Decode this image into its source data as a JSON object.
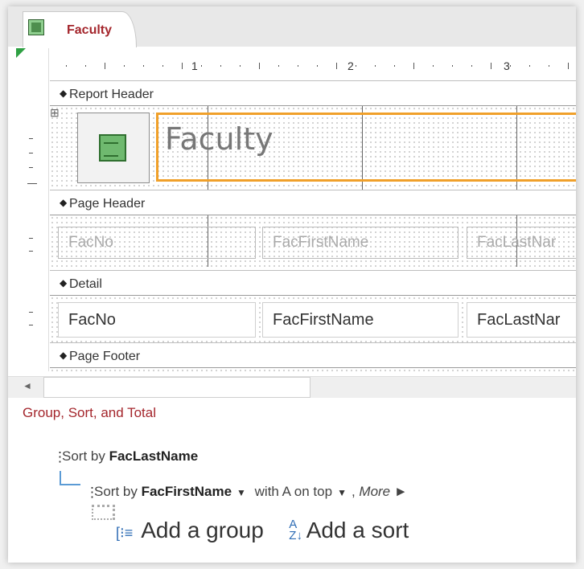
{
  "tab": {
    "label": "Faculty"
  },
  "ruler": {
    "numbers": [
      "1",
      "2",
      "3"
    ]
  },
  "bands": {
    "report_header": "Report Header",
    "page_header": "Page Header",
    "detail": "Detail",
    "page_footer": "Page Footer"
  },
  "report_header": {
    "title": "Faculty"
  },
  "page_header_labels": [
    "FacNo",
    "FacFirstName",
    "FacLastNar"
  ],
  "detail_fields": [
    "FacNo",
    "FacFirstName",
    "FacLastNar"
  ],
  "group_sort": {
    "title": "Group, Sort, and Total",
    "sort1": {
      "prefix": "Sort by",
      "field": "FacLastName"
    },
    "sort2": {
      "prefix": "Sort by",
      "field": "FacFirstName",
      "order": "with A on top",
      "more": "More ►"
    },
    "add_group": "Add a group",
    "add_sort": "Add a sort"
  },
  "colors": {
    "accent": "#a4262c",
    "selection": "#f0a02a",
    "connector": "#5b9bd5"
  }
}
